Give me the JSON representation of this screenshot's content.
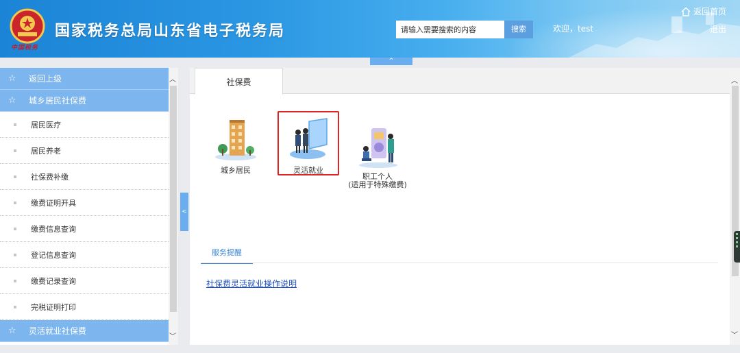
{
  "header": {
    "site_title": "国家税务总局山东省电子税务局",
    "seal_text": "中国税务",
    "search_placeholder": "请输入需要搜索的内容",
    "search_button": "搜索",
    "welcome": "欢迎，test",
    "home_link": "返回首页",
    "logout": "退出",
    "collapse_glyph": "^"
  },
  "sidebar": {
    "back_label": "返回上级",
    "group_label": "城乡居民社保费",
    "items": [
      {
        "label": "居民医疗"
      },
      {
        "label": "居民养老"
      },
      {
        "label": "社保费补缴"
      },
      {
        "label": "缴费证明开具"
      },
      {
        "label": "缴费信息查询"
      },
      {
        "label": "登记信息查询"
      },
      {
        "label": "缴费记录查询"
      },
      {
        "label": "完税证明打印"
      }
    ],
    "next_group_label": "灵活就业社保费",
    "toggle_glyph": "<"
  },
  "main": {
    "tab_label": "社保费",
    "services": [
      {
        "label": "城乡居民",
        "icon": "apartment-building-icon"
      },
      {
        "label": "灵活就业",
        "icon": "flexible-employment-icon",
        "selected": true
      },
      {
        "label": "职工个人\n(适用于特殊缴费)",
        "icon": "employee-individual-icon"
      }
    ],
    "reminder_tab": "服务提醒",
    "guide_link": "社保费灵活就业操作说明"
  },
  "colors": {
    "header_blue": "#1b84d6",
    "sidebar_header": "#7db5ee",
    "selected_border": "#e02424",
    "link": "#1f4fbf",
    "accent": "#3a87d8"
  }
}
